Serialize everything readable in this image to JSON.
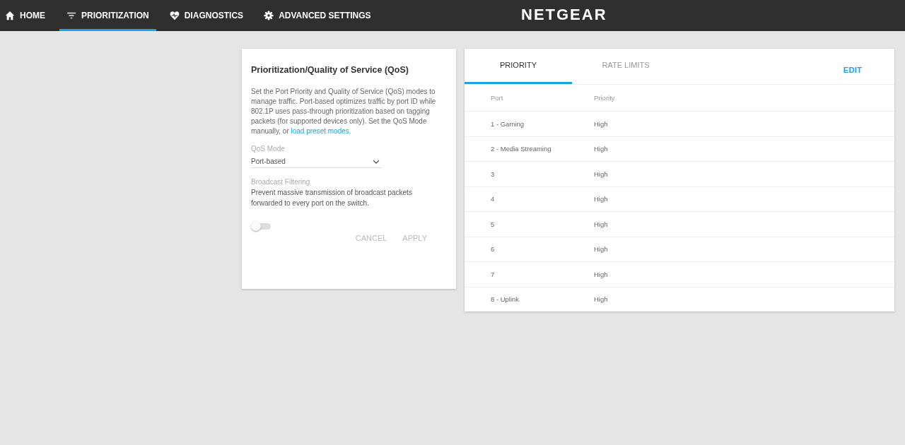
{
  "nav": {
    "items": [
      {
        "label": "HOME",
        "selected": false
      },
      {
        "label": "PRIORITIZATION",
        "selected": true
      },
      {
        "label": "DIAGNOSTICS",
        "selected": false
      },
      {
        "label": "ADVANCED SETTINGS",
        "selected": false
      }
    ],
    "logo": "NETGEAR"
  },
  "qos_card": {
    "title": "Prioritization/Quality of Service (QoS)",
    "description": "Set the Port Priority and Quality of Service (QoS) modes to manage traffic. Port-based optimizes traffic by port ID while 802.1P uses pass-through prioritization based on tagging packets (for supported devices only). Set the QoS Mode manually, or ",
    "link": "load preset modes.",
    "qos_mode": {
      "label": "QoS Mode",
      "value": "Port-based"
    },
    "broadcast_filtering": {
      "label": "Broadcast Filtering",
      "description": "Prevent massive transmission of broadcast packets forwarded to every port on the switch.",
      "on": false
    },
    "buttons": [
      {
        "label": "CANCEL",
        "disabled": true
      },
      {
        "label": "APPLY",
        "disabled": true
      }
    ]
  },
  "priority_card": {
    "tabs": [
      {
        "label": "PRIORITY",
        "selected": true
      },
      {
        "label": "RATE LIMITS",
        "selected": false
      }
    ],
    "edit": "EDIT",
    "columns": [
      "Port",
      "Priority"
    ],
    "rows": [
      {
        "port": "1 - Gaming",
        "priority": "High"
      },
      {
        "port": "2 - Media Streaming",
        "priority": "High"
      },
      {
        "port": "3",
        "priority": "High"
      },
      {
        "port": "4",
        "priority": "High"
      },
      {
        "port": "5",
        "priority": "High"
      },
      {
        "port": "6",
        "priority": "High"
      },
      {
        "port": "7",
        "priority": "High"
      },
      {
        "port": "8 - Uplink",
        "priority": "High"
      }
    ]
  }
}
